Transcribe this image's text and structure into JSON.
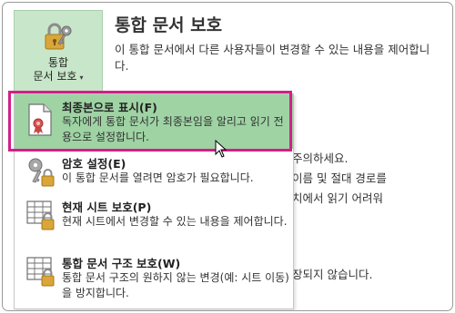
{
  "button": {
    "line1": "통합",
    "line2": "문서 보호",
    "caret": "▾",
    "icon": "lock-key-icon"
  },
  "panel": {
    "title": "통합 문서 보호",
    "description": "이 통합 문서에서 다른 사용자들이 변경할 수 있는 내용을 제어합니다.",
    "partial_lines": [
      "주의하세요.",
      "이름 및 절대 경로를",
      "치에서 읽기 어려워",
      "장되지 않습니다."
    ]
  },
  "menu": {
    "items": [
      {
        "title": "최종본으로 표시(F)",
        "description": "독자에게 통합 문서가 최종본임을 알리고 읽기 전용으로 설정합니다.",
        "icon": "document-ribbon-icon"
      },
      {
        "title": "암호 설정(E)",
        "description": "이 통합 문서를 열려면 암호가 필요합니다.",
        "icon": "key-lock-icon"
      },
      {
        "title": "현재 시트 보호(P)",
        "description": "현재 시트에서 변경할 수 있는 내용을 제어합니다.",
        "icon": "sheet-lock-icon"
      },
      {
        "title": "통합 문서 구조 보호(W)",
        "description": "통합 문서 구조의 원하지 않는 변경(예: 시트 이동)을 방지합니다.",
        "icon": "workbook-lock-icon"
      }
    ]
  },
  "colors": {
    "selected_bg": "#9fd3a4",
    "highlight_border": "#d31f8a",
    "button_bg": "#c8e6c9"
  }
}
